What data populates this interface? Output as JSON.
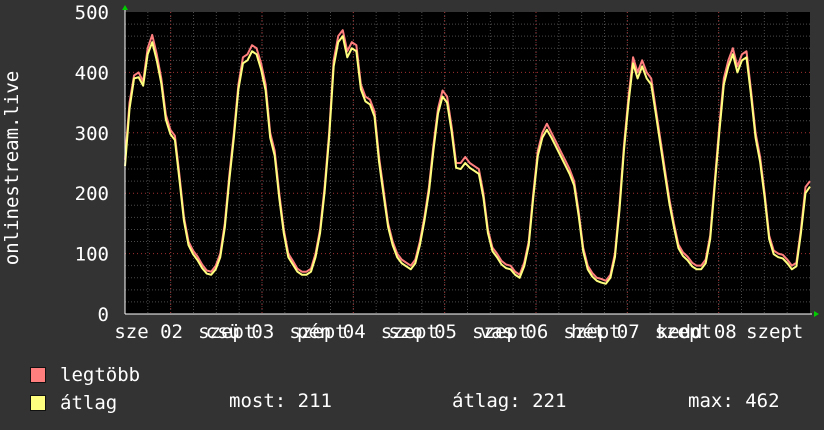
{
  "chart_data": {
    "type": "line",
    "ylabel": "onlinestream.live",
    "ylim": [
      0,
      500
    ],
    "yticks": [
      "0",
      "100",
      "200",
      "300",
      "400",
      "500"
    ],
    "xticklabels": [
      "sze 02",
      "szept",
      "csü 03",
      "szept",
      "pén 04",
      "szept",
      "szo 05",
      "szept",
      "vas 06",
      "szept",
      "hét 07",
      "szept",
      "kedd 08",
      "szept"
    ],
    "grid": true,
    "series": [
      {
        "name": "legtöbb",
        "color": "#ff7f7f",
        "values": [
          255,
          350,
          395,
          400,
          385,
          440,
          462,
          430,
          390,
          330,
          305,
          295,
          230,
          160,
          120,
          105,
          95,
          82,
          72,
          70,
          80,
          100,
          150,
          230,
          300,
          380,
          425,
          430,
          445,
          440,
          415,
          380,
          300,
          270,
          200,
          140,
          100,
          88,
          75,
          70,
          70,
          75,
          100,
          140,
          210,
          300,
          420,
          460,
          470,
          435,
          450,
          445,
          380,
          360,
          355,
          335,
          260,
          205,
          150,
          120,
          100,
          90,
          85,
          80,
          90,
          120,
          160,
          210,
          280,
          340,
          370,
          360,
          310,
          250,
          250,
          260,
          250,
          245,
          240,
          200,
          140,
          110,
          100,
          88,
          82,
          80,
          70,
          65,
          85,
          120,
          200,
          270,
          300,
          315,
          300,
          285,
          270,
          255,
          240,
          220,
          170,
          110,
          80,
          68,
          60,
          58,
          55,
          65,
          100,
          180,
          280,
          360,
          425,
          400,
          420,
          400,
          390,
          340,
          290,
          240,
          190,
          150,
          115,
          102,
          95,
          85,
          80,
          80,
          90,
          130,
          220,
          310,
          390,
          420,
          440,
          410,
          430,
          435,
          370,
          300,
          260,
          200,
          130,
          105,
          100,
          98,
          90,
          80,
          85,
          140,
          210,
          220
        ]
      },
      {
        "name": "átlag",
        "color": "#ffff7f",
        "values": [
          245,
          340,
          390,
          392,
          378,
          430,
          450,
          420,
          382,
          322,
          298,
          288,
          222,
          154,
          114,
          99,
          89,
          76,
          67,
          65,
          74,
          94,
          143,
          222,
          292,
          372,
          415,
          420,
          435,
          430,
          405,
          370,
          292,
          262,
          192,
          134,
          94,
          82,
          70,
          65,
          65,
          70,
          94,
          134,
          202,
          292,
          410,
          450,
          460,
          425,
          440,
          435,
          372,
          352,
          347,
          327,
          252,
          197,
          144,
          114,
          94,
          84,
          79,
          74,
          84,
          114,
          154,
          202,
          272,
          332,
          360,
          350,
          302,
          242,
          240,
          250,
          242,
          237,
          232,
          193,
          134,
          104,
          94,
          82,
          76,
          74,
          65,
          60,
          79,
          114,
          193,
          262,
          292,
          305,
          292,
          277,
          262,
          247,
          232,
          213,
          163,
          104,
          74,
          62,
          55,
          52,
          50,
          60,
          94,
          172,
          272,
          350,
          415,
          390,
          410,
          390,
          380,
          332,
          282,
          232,
          183,
          144,
          109,
          96,
          89,
          79,
          74,
          74,
          84,
          124,
          212,
          300,
          380,
          410,
          430,
          400,
          420,
          425,
          362,
          292,
          252,
          193,
          124,
          99,
          94,
          92,
          84,
          74,
          79,
          134,
          200,
          211
        ]
      }
    ]
  },
  "legend": [
    {
      "label": "legtöbb",
      "color": "#ff7f7f"
    },
    {
      "label": "átlag",
      "color": "#ffff7f"
    }
  ],
  "stats": {
    "current": "most: 211",
    "average": "átlag: 221",
    "max": "max: 462"
  }
}
